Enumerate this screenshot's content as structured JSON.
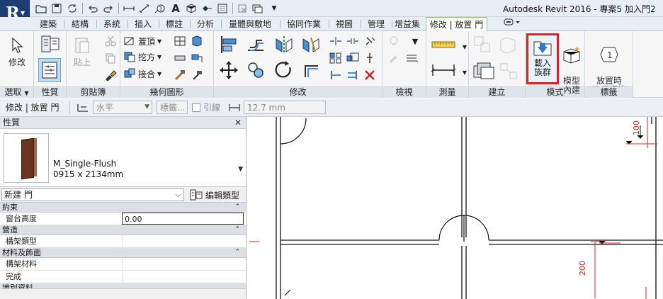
{
  "title": {
    "text": "Autodesk Revit 2016 -     專案5 加入門2"
  },
  "quick_access": {
    "icons": [
      "open-icon",
      "save-icon",
      "sync-icon",
      "undo-icon",
      "redo-icon",
      "measure-icon",
      "dimension-icon",
      "tag-icon",
      "text-icon",
      "3d-view-icon",
      "section-icon",
      "thin-lines-icon",
      "close-windows-icon",
      "switch-windows-icon",
      "customize-icon"
    ]
  },
  "tabs": [
    {
      "label": "建築"
    },
    {
      "label": "結構"
    },
    {
      "label": "系統"
    },
    {
      "label": "插入"
    },
    {
      "label": "標註"
    },
    {
      "label": "分析"
    },
    {
      "label": "量體與敷地"
    },
    {
      "label": "協同作業"
    },
    {
      "label": "視圖"
    },
    {
      "label": "管理"
    },
    {
      "label": "增益集"
    },
    {
      "label": "修改 | 放置 門"
    }
  ],
  "ribbon": {
    "select": {
      "modify_label": "修改",
      "title": "選取"
    },
    "properties": {
      "title": "性質"
    },
    "clipboard": {
      "paste_label": "貼上",
      "title": "剪貼簿"
    },
    "geometry": {
      "cut_label": "蓋頂",
      "join_label": "挖方",
      "union_label": "接合",
      "title": "幾何圖形"
    },
    "modify": {
      "title": "修改"
    },
    "view": {
      "title": "檢視"
    },
    "measure": {
      "title": "測量"
    },
    "create": {
      "title": "建立"
    },
    "mode": {
      "load_family_label": "載入\n族群",
      "in_place_label": "模型\n內建",
      "title": "模式"
    },
    "tag": {
      "tag_on_place_label": "放置時\n進行標籤",
      "title": "標籤"
    }
  },
  "options_bar": {
    "context": "修改 | 放置 門",
    "orientation_value": "水平",
    "tag_label": "標籤...",
    "leader_label": "引線",
    "length_value": "12.7 mm"
  },
  "properties_panel": {
    "title": "性質",
    "close": "✕",
    "family_name": "M_Single-Flush",
    "type_name": "0915 x 2134mm",
    "instance_selector": "新建 門",
    "edit_type_label": "編輯類型",
    "categories": [
      {
        "name": "約束",
        "rows": [
          {
            "name": "窗台高度",
            "value": "0.00"
          }
        ]
      },
      {
        "name": "營造",
        "rows": [
          {
            "name": "構架類型",
            "value": ""
          }
        ]
      },
      {
        "name": "材料及飾面",
        "rows": [
          {
            "name": "構架材料",
            "value": ""
          },
          {
            "name": "完成",
            "value": ""
          }
        ]
      },
      {
        "name": "識別資料",
        "rows": []
      }
    ]
  },
  "canvas": {
    "dim_top": "100",
    "dim_side": "200"
  },
  "colors": {
    "accent_green": "#90c070",
    "highlight_red": "#e02020",
    "app_blue": "#1c3e75",
    "dimension_red": "#e02020"
  }
}
